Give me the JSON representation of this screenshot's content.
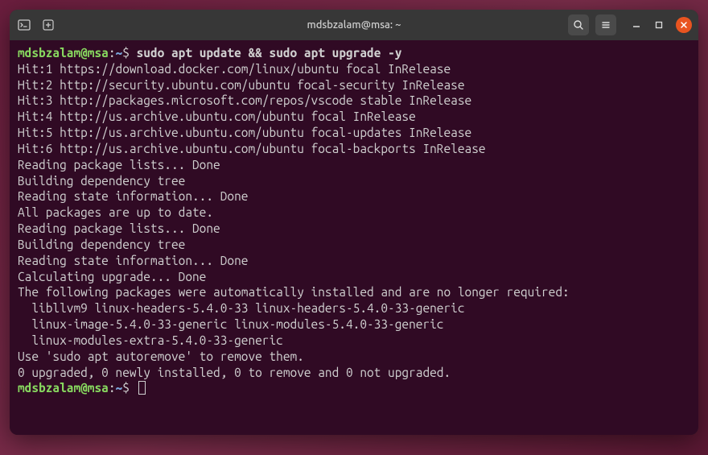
{
  "window": {
    "title": "mdsbzalam@msa: ~"
  },
  "prompt": {
    "user_host": "mdsbzalam@msa",
    "path": "~",
    "symbol": "$"
  },
  "command": "sudo apt update && sudo apt upgrade -y",
  "output_lines": [
    "Hit:1 https://download.docker.com/linux/ubuntu focal InRelease",
    "Hit:2 http://security.ubuntu.com/ubuntu focal-security InRelease",
    "Hit:3 http://packages.microsoft.com/repos/vscode stable InRelease",
    "Hit:4 http://us.archive.ubuntu.com/ubuntu focal InRelease",
    "Hit:5 http://us.archive.ubuntu.com/ubuntu focal-updates InRelease",
    "Hit:6 http://us.archive.ubuntu.com/ubuntu focal-backports InRelease",
    "Reading package lists... Done",
    "Building dependency tree",
    "Reading state information... Done",
    "All packages are up to date.",
    "Reading package lists... Done",
    "Building dependency tree",
    "Reading state information... Done",
    "Calculating upgrade... Done",
    "The following packages were automatically installed and are no longer required:",
    "  libllvm9 linux-headers-5.4.0-33 linux-headers-5.4.0-33-generic",
    "  linux-image-5.4.0-33-generic linux-modules-5.4.0-33-generic",
    "  linux-modules-extra-5.4.0-33-generic",
    "Use 'sudo apt autoremove' to remove them.",
    "0 upgraded, 0 newly installed, 0 to remove and 0 not upgraded."
  ]
}
